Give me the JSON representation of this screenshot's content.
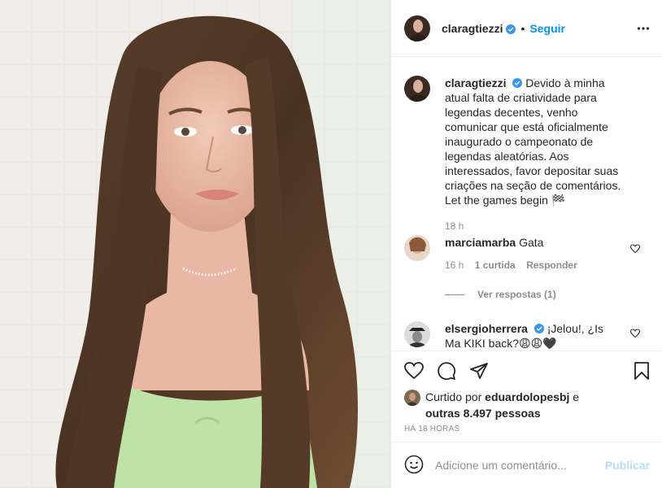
{
  "header": {
    "username": "claragtiezzi",
    "separator": "•",
    "follow_label": "Seguir"
  },
  "caption": {
    "username": "claragtiezzi",
    "text": "Devido à minha atual falta de criatividade para legendas decentes, venho comunicar que está oficialmente inaugurado o campeonato de legendas aleatórias. Aos interessados, favor depositar suas criações na seção de comentários. Let the games begin 🏁",
    "time": "18 h"
  },
  "comments": [
    {
      "username": "marciamarba",
      "text": "Gata",
      "time": "16 h",
      "likes": "1 curtida",
      "reply": "Responder",
      "view_replies": "Ver respostas (1)"
    },
    {
      "username": "elsergioherrera",
      "text": "¡Jelou!, ¿Is Ma KIKI back?😩😩🖤"
    }
  ],
  "likes": {
    "prefix": "Curtido por",
    "user": "eduardolopesbj",
    "middle": "e",
    "others": "outras 8.497 pessoas"
  },
  "timestamp": "HÁ 18 HORAS",
  "add_comment": {
    "placeholder": "Adicione um comentário...",
    "publish_label": "Publicar"
  },
  "icons": [
    "more-options-icon",
    "heart-icon",
    "comment-icon",
    "share-icon",
    "bookmark-icon",
    "emoji-icon",
    "verified-icon"
  ],
  "colors": {
    "link": "#0095f6",
    "publish_disabled": "#b3dbff",
    "muted": "#8e8e8e",
    "text": "#262626"
  }
}
